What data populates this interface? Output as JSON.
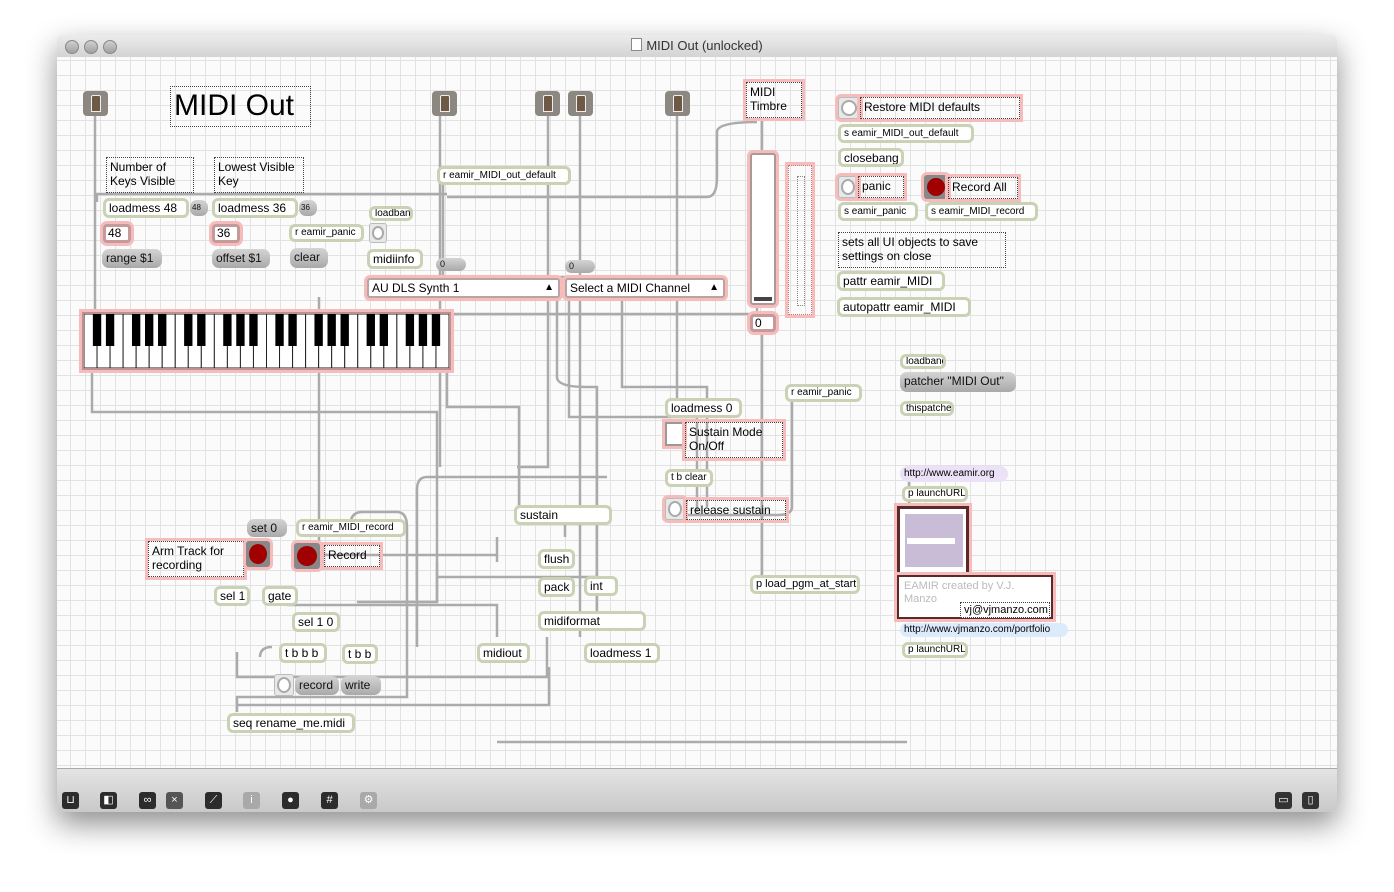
{
  "window": {
    "title": "MIDI Out (unlocked)"
  },
  "patch": {
    "title": "MIDI Out",
    "comment_num_keys": "Number of Keys Visible",
    "comment_lowest_key": "Lowest Visible Key",
    "loadmess48": "loadmess 48",
    "msg48": "48",
    "num48": "48",
    "loadmess36": "loadmess 36",
    "msg36": "36",
    "num36": "36",
    "range": "range $1",
    "offset": "offset $1",
    "clear": "clear",
    "r_panic": "r eamir_panic",
    "loadbang": "loadbang",
    "midiinfo": "midiinfo",
    "r_default": "r eamir_MIDI_out_default",
    "msg0a": "0",
    "msg0b": "0",
    "synth_menu": "AU DLS Synth 1",
    "channel_menu": "Select a MIDI Channel",
    "midi_timbre": "MIDI Timbre",
    "timbre_value": "0",
    "restore": "Restore MIDI defaults",
    "s_default": "s eamir_MIDI_out_default",
    "closebang": "closebang",
    "panic": "panic",
    "record_all": "Record All",
    "s_panic": "s eamir_panic",
    "s_record": "s eamir_MIDI_record",
    "sets_comment": "sets all UI objects to save settings on close",
    "pattr": "pattr eamir_MIDI",
    "autopattr": "autopattr eamir_MIDI",
    "loadbang2": "loadbang",
    "patcher_msg": "patcher \"MIDI Out\"",
    "thispatcher": "thispatcher",
    "r_panic2": "r eamir_panic",
    "loadmess0": "loadmess 0",
    "sustain_mode": "Sustain Mode On/Off",
    "tb_clear": "t b clear",
    "release_sustain": "release sustain",
    "sustain": "sustain",
    "flush": "flush",
    "pack": "pack",
    "int": "int",
    "midiformat": "midiformat",
    "loadmess1": "loadmess 1",
    "midiout": "midiout",
    "load_pgm": "p load_pgm_at_start",
    "set0": "set 0",
    "r_record": "r eamir_MIDI_record",
    "arm_track": "Arm Track for recording",
    "record_label": "Record",
    "sel1": "sel 1",
    "gate": "gate",
    "sel10": "sel 1 0",
    "tbbb": "t b b b",
    "tbb": "t b b",
    "record_msg": "record",
    "write_msg": "write",
    "seq": "seq rename_me.midi",
    "eamir_url": "http://www.eamir.org",
    "launch1": "p launchURL",
    "credits": "EAMIR created by V.J. Manzo",
    "email": "vj@vjmanzo.com",
    "portfolio_url": "http://www.vjmanzo.com/portfolio",
    "launch2": "p launchURL"
  },
  "toolbar": {
    "icons": [
      "lock-icon",
      "new-view-icon",
      "binoculars-icon",
      "close-box-icon",
      "presentation-icon",
      "info-icon",
      "patch-cord-icon",
      "grid-icon",
      "gear-icon"
    ],
    "info": "i"
  }
}
